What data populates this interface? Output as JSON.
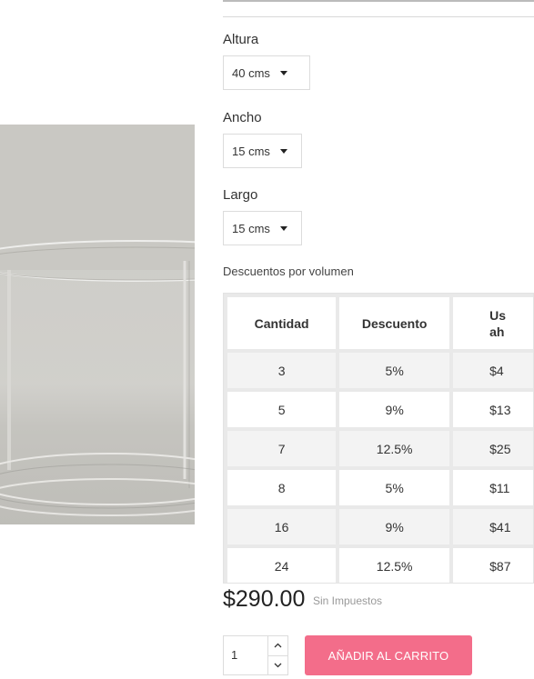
{
  "options": {
    "altura": {
      "label": "Altura",
      "value": "40 cms"
    },
    "ancho": {
      "label": "Ancho",
      "value": "15 cms"
    },
    "largo": {
      "label": "Largo",
      "value": "15 cms"
    }
  },
  "discounts": {
    "label": "Descuentos por volumen",
    "headers": [
      "Cantidad",
      "Descuento",
      "Us ah"
    ],
    "rows": [
      [
        "3",
        "5%",
        "$4"
      ],
      [
        "5",
        "9%",
        "$13"
      ],
      [
        "7",
        "12.5%",
        "$25"
      ],
      [
        "8",
        "5%",
        "$11"
      ],
      [
        "16",
        "9%",
        "$41"
      ],
      [
        "24",
        "12.5%",
        "$87"
      ]
    ]
  },
  "price": {
    "value": "$290.00",
    "tax_note": "Sin Impuestos"
  },
  "cart": {
    "quantity": "1",
    "add_label": "AÑADIR AL CARRITO"
  },
  "colors": {
    "accent": "#f36d8a",
    "text": "#333333",
    "border": "#dcdcdc"
  },
  "icons": {
    "caret": "chevron-down-icon",
    "up": "chevron-up-icon",
    "down": "chevron-down-icon"
  }
}
